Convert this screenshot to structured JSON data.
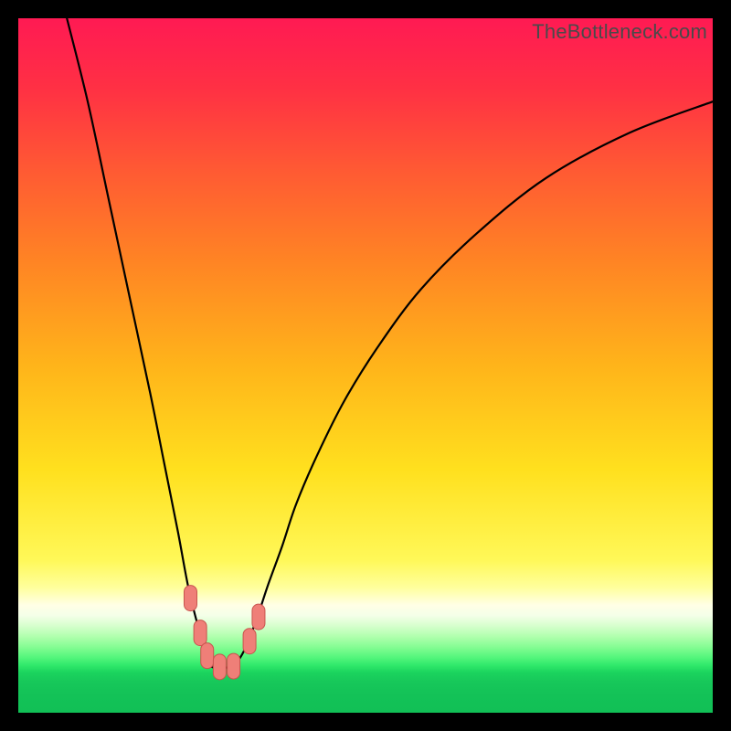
{
  "watermark": "TheBottleneck.com",
  "colors": {
    "bg": "#000000",
    "curve": "#000000",
    "marker_fill": "#ef7f78",
    "marker_stroke": "#c9544e",
    "gradient_stops": [
      {
        "offset": 0.0,
        "color": "#ff1a53"
      },
      {
        "offset": 0.1,
        "color": "#ff3044"
      },
      {
        "offset": 0.22,
        "color": "#ff5a33"
      },
      {
        "offset": 0.35,
        "color": "#ff8424"
      },
      {
        "offset": 0.5,
        "color": "#ffb41a"
      },
      {
        "offset": 0.65,
        "color": "#ffe01e"
      },
      {
        "offset": 0.78,
        "color": "#fff858"
      },
      {
        "offset": 0.82,
        "color": "#ffff9d"
      },
      {
        "offset": 0.845,
        "color": "#ffffe6"
      },
      {
        "offset": 0.86,
        "color": "#f4ffe8"
      },
      {
        "offset": 0.875,
        "color": "#d6ffcd"
      },
      {
        "offset": 0.89,
        "color": "#b1ffae"
      },
      {
        "offset": 0.905,
        "color": "#86fd94"
      },
      {
        "offset": 0.92,
        "color": "#55f67c"
      },
      {
        "offset": 0.932,
        "color": "#2fe86a"
      },
      {
        "offset": 0.942,
        "color": "#1bd45e"
      },
      {
        "offset": 0.955,
        "color": "#17c85a"
      },
      {
        "offset": 0.975,
        "color": "#13c257"
      },
      {
        "offset": 1.0,
        "color": "#11c056"
      }
    ]
  },
  "chart_data": {
    "type": "line",
    "title": "",
    "xlabel": "",
    "ylabel": "",
    "xlim": [
      0,
      100
    ],
    "ylim": [
      0,
      100
    ],
    "grid": false,
    "legend": false,
    "series": [
      {
        "name": "curve",
        "x": [
          7,
          10,
          13,
          16,
          19,
          21,
          23,
          24.5,
          26,
          27,
          27.7,
          28.2,
          29,
          30,
          31,
          32,
          33,
          34.5,
          36,
          38,
          40,
          43,
          47,
          52,
          58,
          66,
          76,
          88,
          100
        ],
        "values": [
          100,
          88,
          74,
          60,
          46,
          36,
          26,
          18,
          12,
          8.5,
          6.8,
          6.5,
          6.5,
          6.5,
          6.8,
          8,
          10,
          14,
          18.5,
          24,
          30,
          37,
          45,
          53,
          61,
          69,
          77,
          83.5,
          88
        ]
      }
    ],
    "markers": [
      {
        "x": 24.8,
        "y": 16.5
      },
      {
        "x": 26.2,
        "y": 11.5
      },
      {
        "x": 27.2,
        "y": 8.2
      },
      {
        "x": 29.0,
        "y": 6.6
      },
      {
        "x": 31.0,
        "y": 6.7
      },
      {
        "x": 33.3,
        "y": 10.3
      },
      {
        "x": 34.6,
        "y": 13.8
      }
    ]
  }
}
